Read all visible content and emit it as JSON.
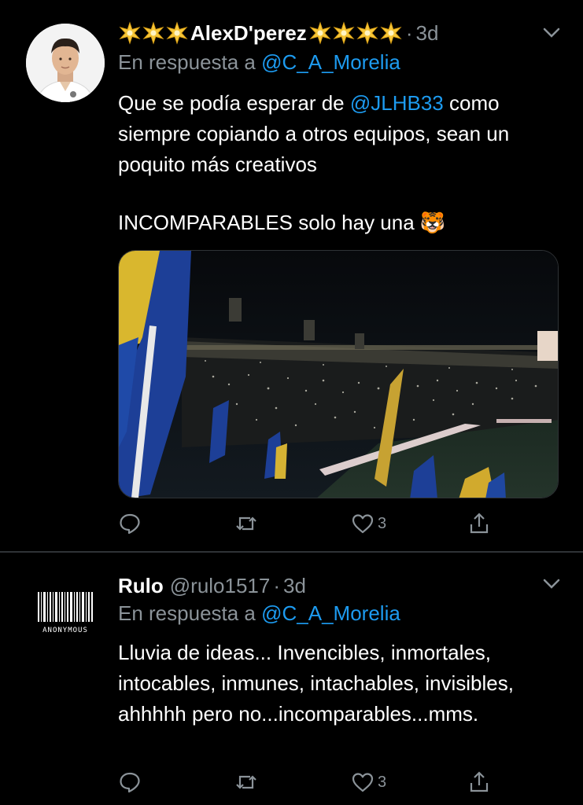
{
  "colors": {
    "background": "#000000",
    "text": "#ffffff",
    "secondary": "#8b9399",
    "link": "#1d9bf0",
    "divider": "#2f3336"
  },
  "tweets": [
    {
      "display_name": "AlexD'perez",
      "decorations": {
        "left_icon": "star-icon",
        "left_count": 3,
        "right_icon": "star-icon",
        "right_count": 4
      },
      "separator": "·",
      "time": "3d",
      "reply_prefix": "En respuesta a",
      "reply_to": "@C_A_Morelia",
      "text_part1": "Que se podía esperar de ",
      "text_mention": "@JLHB33",
      "text_part2": " como siempre copiando a otros equipos, sean un poquito más creativos",
      "text_line2": "INCOMPARABLES solo hay una 🐯",
      "media": "stadium-night-photo",
      "actions": {
        "reply_icon": "reply-icon",
        "retweet_icon": "retweet-icon",
        "like_icon": "like-icon",
        "likes": "3",
        "share_icon": "share-icon"
      }
    },
    {
      "display_name": "Rulo",
      "handle": "@rulo1517",
      "separator": "·",
      "time": "3d",
      "avatar_label": "ANONYMOUS",
      "reply_prefix": "En respuesta a",
      "reply_to": "@C_A_Morelia",
      "text": "Lluvia de ideas... Invencibles, inmortales, intocables, inmunes, intachables, invisibles, ahhhhh pero no...incomparables...mms.",
      "actions": {
        "reply_icon": "reply-icon",
        "retweet_icon": "retweet-icon",
        "like_icon": "like-icon",
        "likes": "3",
        "share_icon": "share-icon"
      }
    }
  ]
}
